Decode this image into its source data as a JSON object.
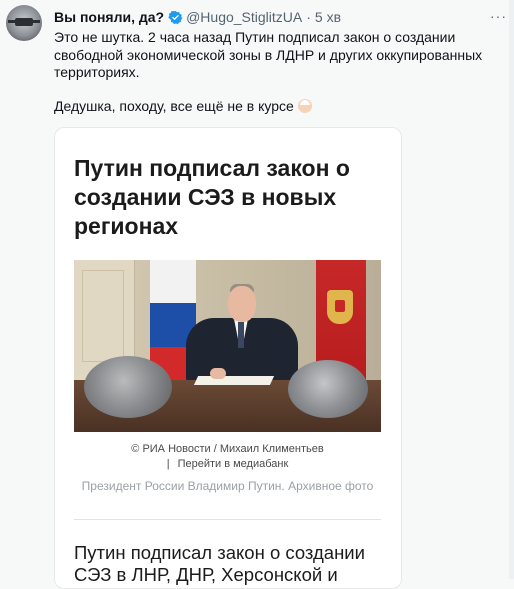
{
  "tweet": {
    "author_name": "Вы поняли, да?",
    "handle": "@Hugo_StiglitzUA",
    "separator": "·",
    "time": "5 хв",
    "more_label": "···",
    "text_line1": "Это не шутка. 2 часа назад Путин подписал закон о создании свободной экономической зоны в ЛДНР и других оккупированных территориях.",
    "text_line2": "Дедушка, походу, все ещё не в курсе"
  },
  "card": {
    "title": "Путин подписал закон о создании СЭЗ в новых регионах",
    "photo_credit": "© РИА Новости / Михаил Климентьев",
    "media_link": "Перейти в медиабанк",
    "link_separator": "|",
    "photo_description": "Президент России Владимир Путин. Архивное фото",
    "bottom_headline": "Путин подписал закон о создании СЭЗ в ЛНР, ДНР, Херсонской и"
  },
  "colors": {
    "verified_blue": "#1d9bf0",
    "secondary_text": "#536471",
    "background": "#f7f9f9"
  },
  "icons": {
    "verified": "verified-badge-icon",
    "more": "more-horizontal-icon",
    "emoji": "old-man-emoji-icon"
  }
}
